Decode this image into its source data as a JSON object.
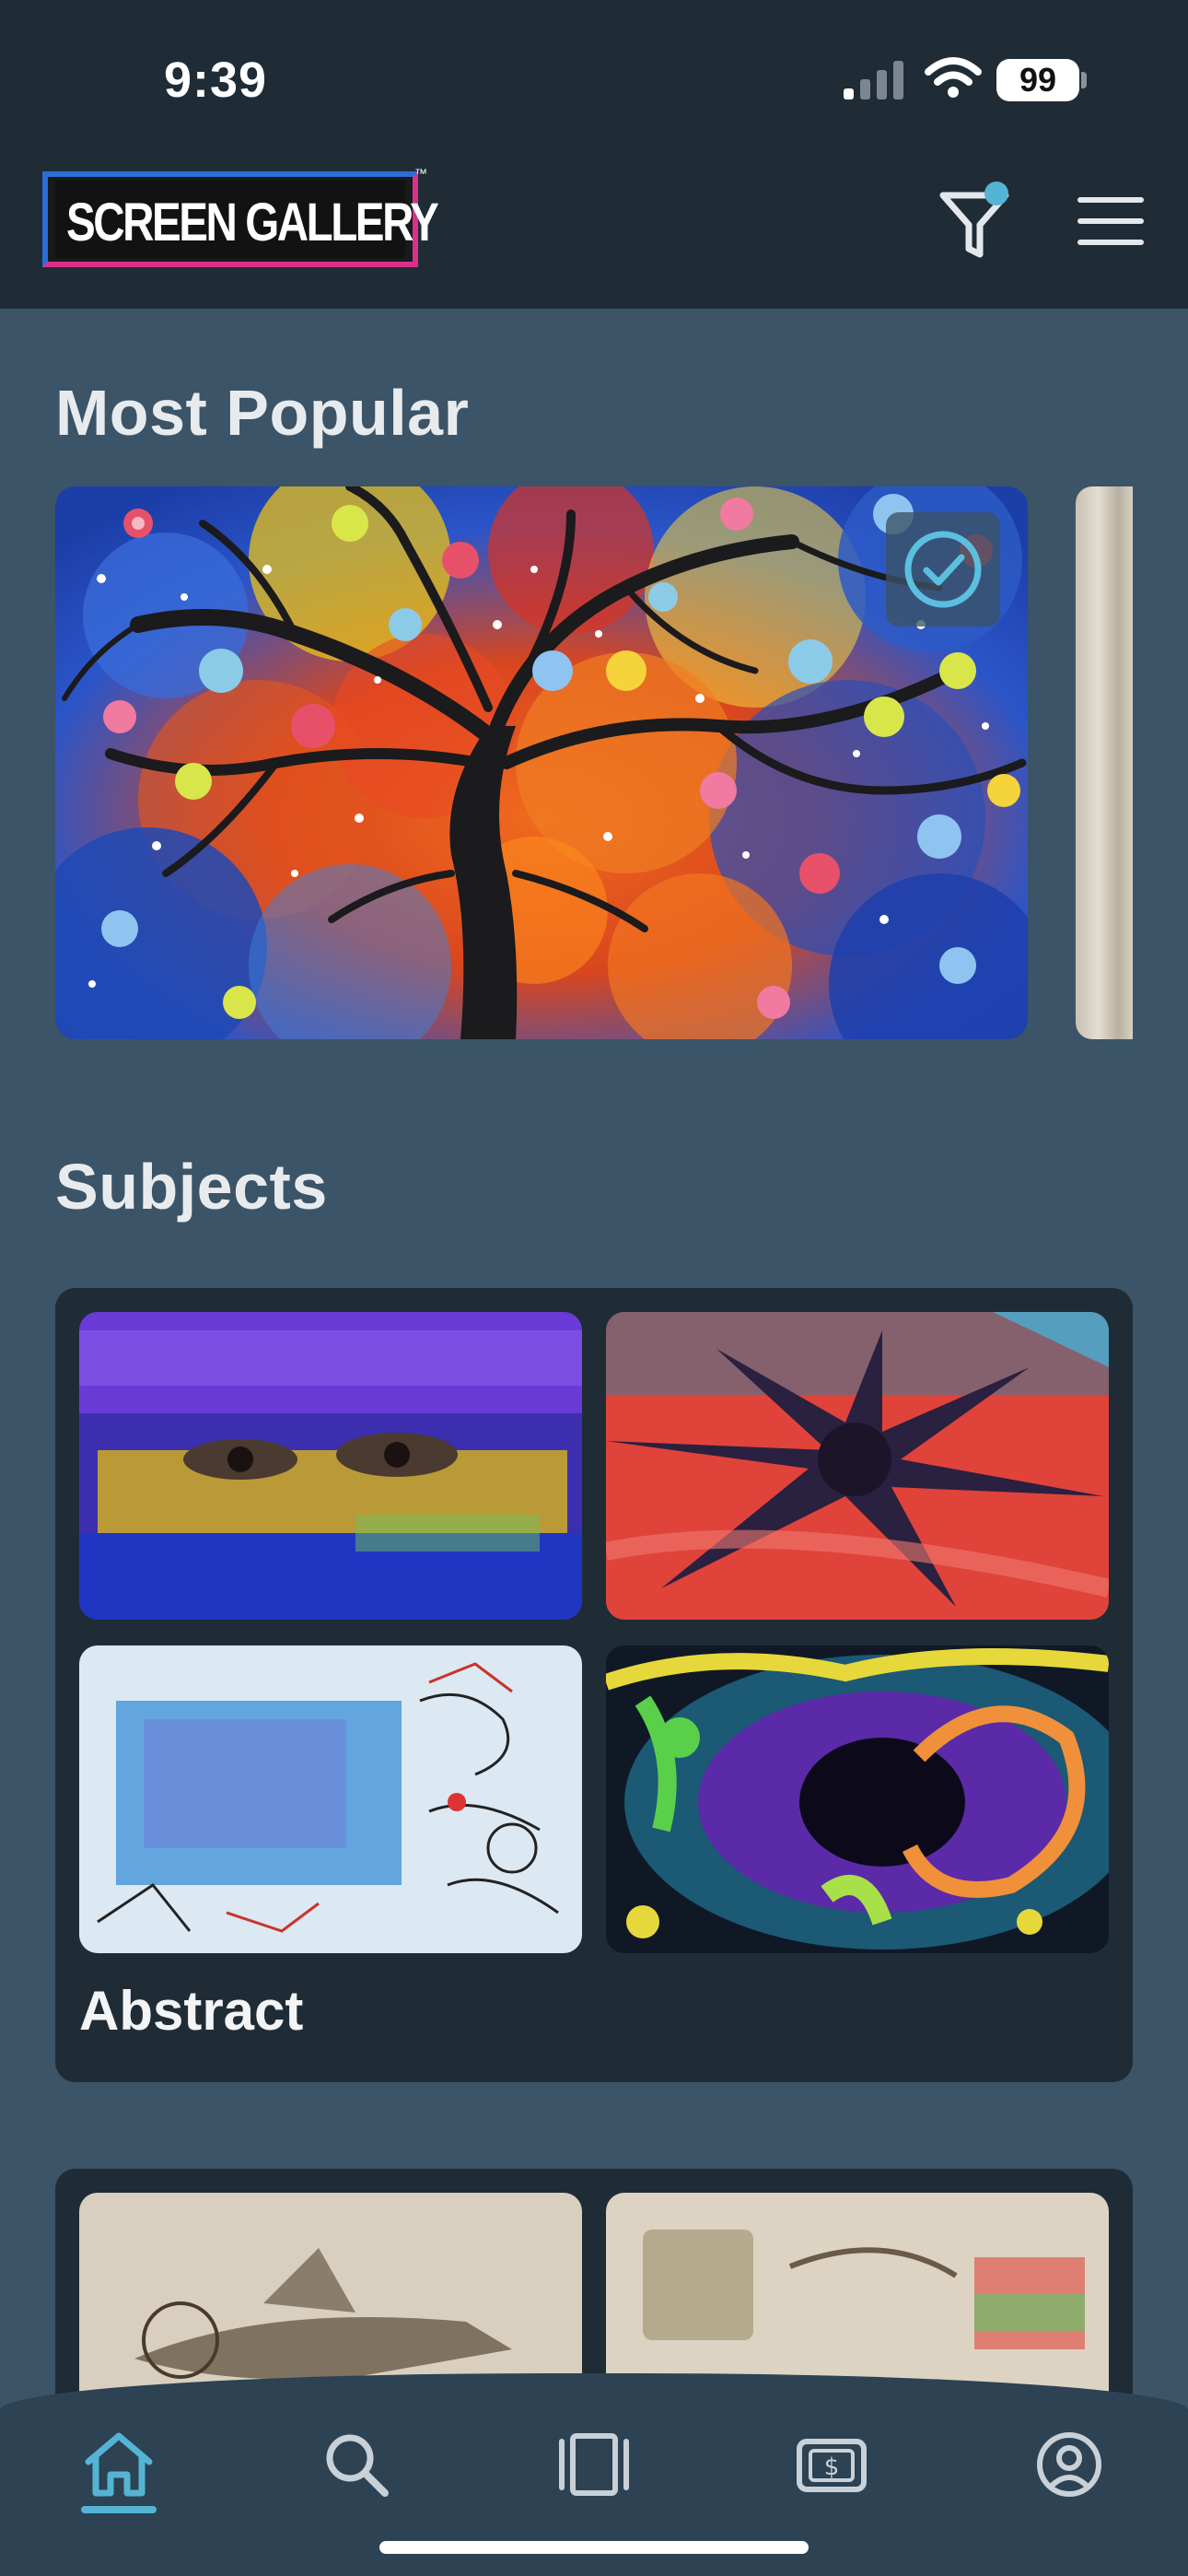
{
  "status_bar": {
    "time": "9:39",
    "battery_level": "99"
  },
  "header": {
    "logo_text": "SCREEN GALLERY",
    "logo_trademark": "™",
    "filter_icon": "filter-icon",
    "menu_icon": "hamburger-menu-icon"
  },
  "sections": {
    "most_popular": {
      "title": "Most Popular",
      "selected": true
    },
    "subjects": {
      "title": "Subjects",
      "categories": [
        {
          "label": "Abstract"
        }
      ]
    }
  },
  "bottom_nav": {
    "items": [
      {
        "icon": "home-icon",
        "active": true
      },
      {
        "icon": "search-icon",
        "active": false
      },
      {
        "icon": "carousel-icon",
        "active": false
      },
      {
        "icon": "purchase-icon",
        "active": false
      },
      {
        "icon": "account-icon",
        "active": false
      }
    ]
  },
  "colors": {
    "header_bg": "#1f2c36",
    "page_bg": "#3b5467",
    "card_bg": "#1f2c36",
    "accent": "#54b4d4",
    "logo_blue": "#2a6fd6",
    "logo_pink": "#d9318a"
  }
}
